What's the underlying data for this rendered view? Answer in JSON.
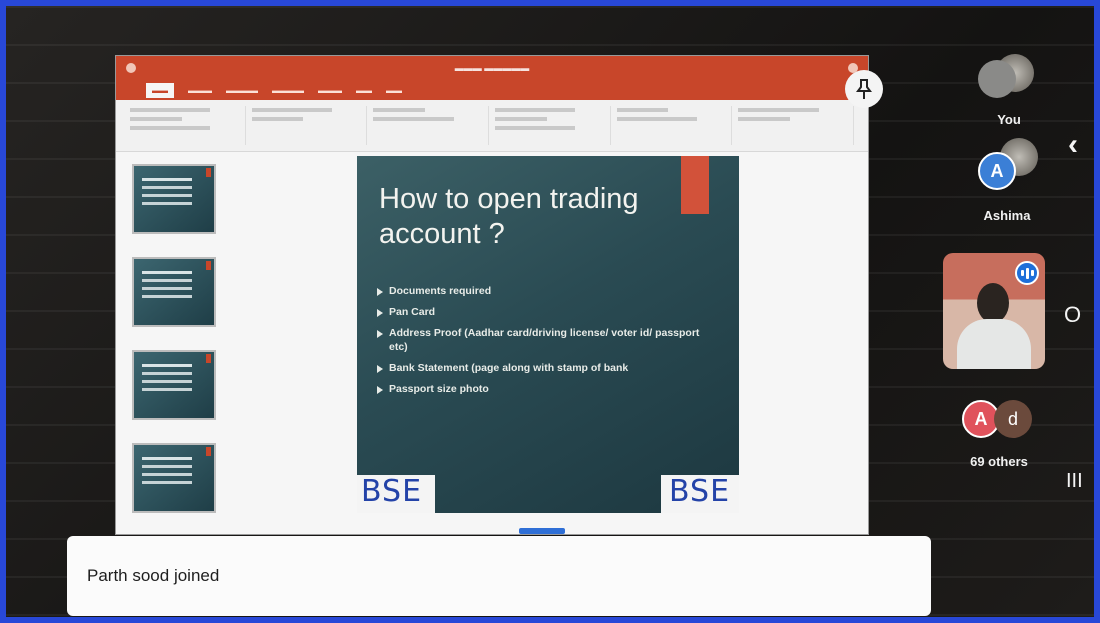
{
  "slide": {
    "title": "How to open trading account ?",
    "bullets": [
      "Documents required",
      "Pan Card",
      "Address Proof (Aadhar card/driving license/ voter id/ passport etc)",
      "Bank Statement (page along with stamp of bank",
      "Passport size photo"
    ],
    "logo_left": "BSE",
    "logo_right": "BSE"
  },
  "participants": {
    "you_label": "You",
    "ashima_label": "Ashima",
    "ashima_initial": "A",
    "others_initial_1": "A",
    "others_initial_2": "d",
    "others_label": "69 others",
    "colors": {
      "ashima": "#3b7fd6",
      "others_a": "#e0525c",
      "others_d": "#6b4a3c",
      "speaking": "#1e6fd9"
    }
  },
  "controls": {
    "collapse_icon": "chevron-left-icon",
    "camera_icon": "circle-icon",
    "menu_icon": "bars-icon",
    "pin_icon": "pin-icon",
    "collapse_glyph": "‹",
    "camera_glyph": "O",
    "menu_glyph": "III"
  },
  "notification": {
    "text": "Parth sood joined"
  },
  "colors": {
    "frame": "#2848d8",
    "ppt_accent": "#c8462a",
    "slide_bg": "#2a4b53"
  }
}
